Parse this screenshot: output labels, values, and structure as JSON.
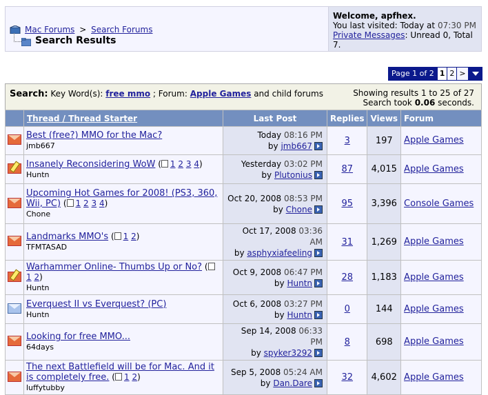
{
  "breadcrumb": {
    "home": "Mac Forums",
    "separator": ">",
    "section": "Search Forums",
    "title": "Search Results"
  },
  "welcome": {
    "heading": "Welcome, apfhex.",
    "last_visited_prefix": "You last visited: Today at",
    "last_visited_time": "07:30 PM",
    "pm_link": "Private Messages",
    "pm_status": ": Unread 0, Total 7."
  },
  "pagenav": {
    "label": "Page 1 of 2",
    "current": "1",
    "next_page": "2",
    "next_arrow": ">"
  },
  "search": {
    "label": "Search:",
    "keyword_label": "Key Word(s):",
    "keyword": "free mmo",
    "forum_label": "; Forum:",
    "forum": "Apple Games",
    "forum_suffix": "and child forums",
    "results_info": "Showing results 1 to 25 of 27",
    "time_prefix": "Search took",
    "time_value": "0.06",
    "time_suffix": "seconds."
  },
  "columns": {
    "thread": "Thread / Thread Starter",
    "last_post": "Last Post",
    "replies": "Replies",
    "views": "Views",
    "forum": "Forum"
  },
  "threads": [
    {
      "icon": "hot-folder-icon",
      "title": "Best (free?) MMO for the Mac?",
      "pages": "",
      "starter": "jmb667",
      "date": "Today",
      "time": "08:16 PM",
      "by": "by",
      "last_poster": "jmb667",
      "replies": "3",
      "views": "197",
      "forum": "Apple Games"
    },
    {
      "icon": "posted-hot-folder-icon",
      "title": "Insanely Reconsidering WoW",
      "pages": "1 2 3 4",
      "starter": "Huntn",
      "date": "Yesterday",
      "time": "03:02 PM",
      "by": "by",
      "last_poster": "Plutonius",
      "replies": "87",
      "views": "4,015",
      "forum": "Apple Games"
    },
    {
      "icon": "hot-folder-icon",
      "title": "Upcoming Hot Games for 2008! (PS3, 360, Wii, PC)",
      "pages": "1 2 3 4",
      "starter": "Chone",
      "date": "Oct 20, 2008",
      "time": "08:53 PM",
      "by": "by",
      "last_poster": "Chone",
      "replies": "95",
      "views": "3,396",
      "forum": "Console Games"
    },
    {
      "icon": "hot-folder-icon",
      "title": "Landmarks MMO's",
      "pages": "1 2",
      "starter": "TFMTASAD",
      "date": "Oct 17, 2008",
      "time": "03:36 AM",
      "by": "by",
      "last_poster": "asphyxiafeeling",
      "replies": "31",
      "views": "1,269",
      "forum": "Apple Games"
    },
    {
      "icon": "posted-hot-folder-icon",
      "title": "Warhammer Online- Thumbs Up or No?",
      "pages": "1 2",
      "starter": "Huntn",
      "date": "Oct 9, 2008",
      "time": "06:47 PM",
      "by": "by",
      "last_poster": "Huntn",
      "replies": "28",
      "views": "1,183",
      "forum": "Apple Games"
    },
    {
      "icon": "new-folder-icon",
      "title": "Everquest II vs Everquest? (PC)",
      "pages": "",
      "starter": "Huntn",
      "date": "Oct 6, 2008",
      "time": "03:27 PM",
      "by": "by",
      "last_poster": "Huntn",
      "replies": "0",
      "views": "144",
      "forum": "Apple Games"
    },
    {
      "icon": "hot-folder-icon",
      "title": "Looking for free MMO...",
      "pages": "",
      "starter": "64days",
      "date": "Sep 14, 2008",
      "time": "06:33 PM",
      "by": "by",
      "last_poster": "spyker3292",
      "replies": "8",
      "views": "698",
      "forum": "Apple Games"
    },
    {
      "icon": "hot-folder-icon",
      "title": "The next Battlefield will be for Mac. And it is completely free.",
      "pages": "1 2",
      "starter": "luffytubby",
      "date": "Sep 5, 2008",
      "time": "05:24 AM",
      "by": "by",
      "last_poster": "Dan.Dare",
      "replies": "32",
      "views": "4,602",
      "forum": "Apple Games"
    }
  ]
}
